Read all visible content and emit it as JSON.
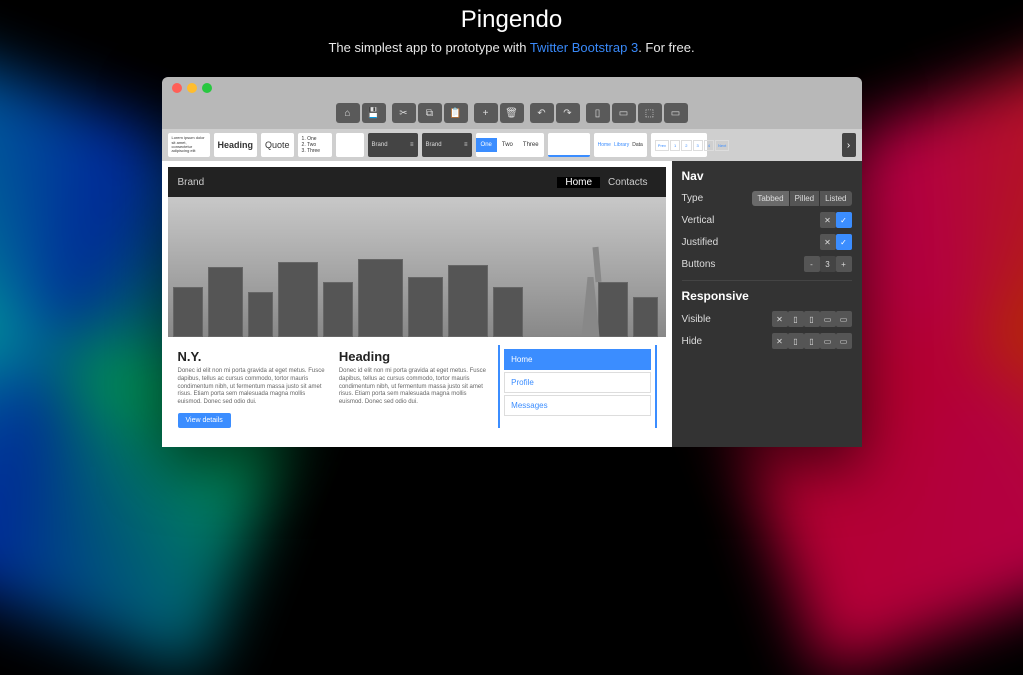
{
  "hero": {
    "title": "Pingendo",
    "subtitle_pre": "The simplest app to prototype with ",
    "subtitle_link": "Twitter Bootstrap 3",
    "subtitle_post": ". For free."
  },
  "components": {
    "lorem": "Lorem ipsum dolor sit amet, consectetur adipiscing elit",
    "heading": "Heading",
    "quote": "Quote",
    "list": "1. One\n2. Two\n3. Three",
    "brand1": "Brand",
    "brand2": "Brand",
    "tabs": [
      "One",
      "Two",
      "Three"
    ],
    "breadcrumb": [
      "Home",
      "Library",
      "Data"
    ]
  },
  "canvas": {
    "brand": "Brand",
    "navlinks": [
      "Home",
      "Contacts"
    ],
    "col1": {
      "title": "N.Y.",
      "body": "Donec id elit non mi porta gravida at eget metus. Fusce dapibus, tellus ac cursus commodo, tortor mauris condimentum nibh, ut fermentum massa justo sit amet risus. Etiam porta sem malesuada magna mollis euismod. Donec sed odio dui.",
      "button": "View details"
    },
    "col2": {
      "title": "Heading",
      "body": "Donec id elit non mi porta gravida at eget metus. Fusce dapibus, tellus ac cursus commodo, tortor mauris condimentum nibh, ut fermentum massa justo sit amet risus. Etiam porta sem malesuada magna mollis euismod. Donec sed odio dui."
    },
    "col3": {
      "items": [
        "Home",
        "Profile",
        "Messages"
      ]
    }
  },
  "inspector": {
    "section1": "Nav",
    "type_label": "Type",
    "type_options": [
      "Tabbed",
      "Pilled",
      "Listed"
    ],
    "vertical_label": "Vertical",
    "justified_label": "Justified",
    "buttons_label": "Buttons",
    "buttons_value": "3",
    "section2": "Responsive",
    "visible_label": "Visible",
    "hide_label": "Hide"
  }
}
